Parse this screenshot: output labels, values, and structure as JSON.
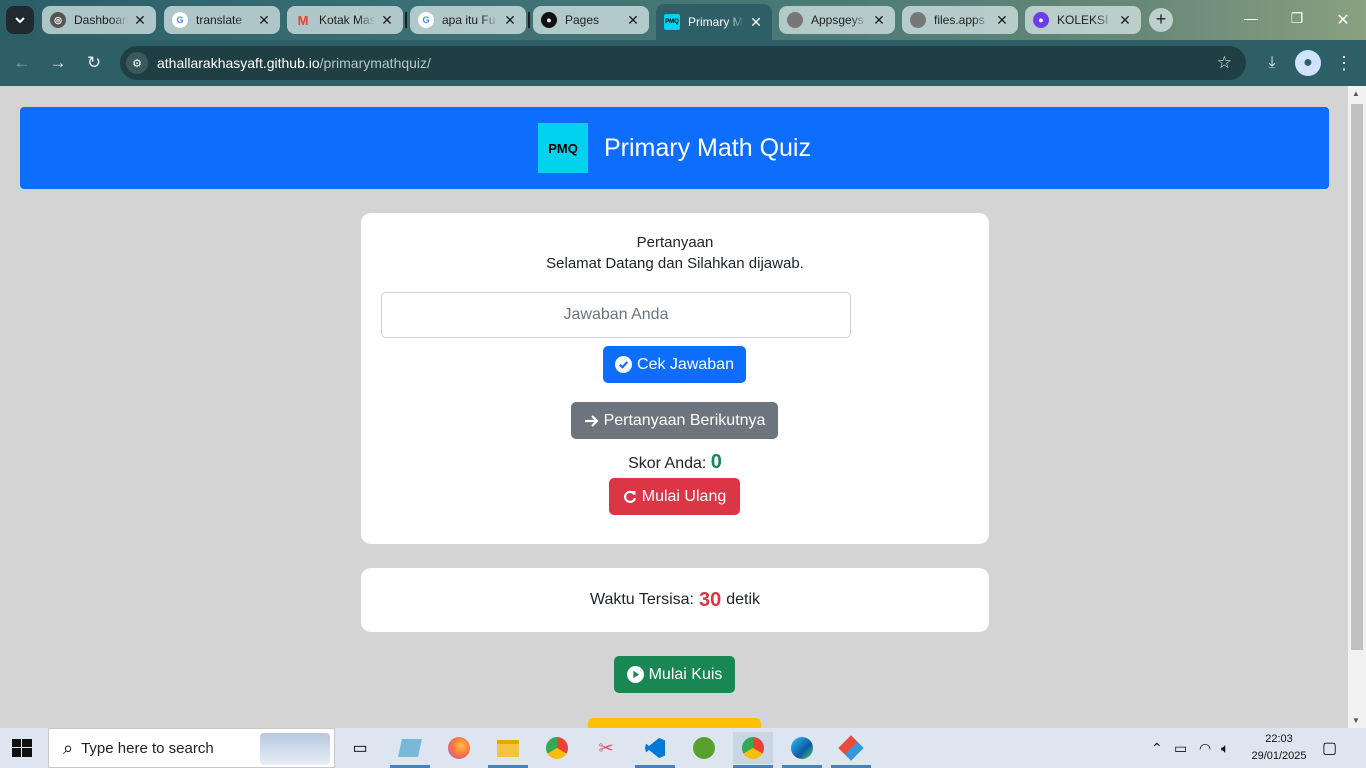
{
  "browser": {
    "tabs": [
      {
        "label": "Dashboard",
        "favicon": "openai-icon",
        "color": "#555555"
      },
      {
        "label": "translate",
        "favicon": "google-icon",
        "color": "#4285f4"
      },
      {
        "label": "Kotak Masuk",
        "favicon": "gmail-icon",
        "color": "#ea4335"
      },
      {
        "label": "apa itu Fu",
        "favicon": "google-icon",
        "color": "#4285f4"
      },
      {
        "label": "Pages",
        "favicon": "github-icon",
        "color": "#111111"
      },
      {
        "label": "Primary M",
        "favicon": "pmq-icon",
        "color": "#00d2f0"
      },
      {
        "label": "Appsgeys",
        "favicon": "globe-icon",
        "color": "#777777"
      },
      {
        "label": "files.apps",
        "favicon": "globe-icon",
        "color": "#777777"
      },
      {
        "label": "KOLEKSI F",
        "favicon": "shield-icon",
        "color": "#6a3de8"
      }
    ],
    "url_domain": "athallarakhasyaft.github.io",
    "url_path": "/primarymathquiz/"
  },
  "page": {
    "logo_text": "PMQ",
    "header_title": "Primary Math Quiz",
    "question_title": "Pertanyaan",
    "question_text": "Selamat Datang dan Silahkan dijawab.",
    "answer_placeholder": "Jawaban Anda",
    "check_button": "Cek Jawaban",
    "next_button": "Pertanyaan Berikutnya",
    "score_label": "Skor Anda:",
    "score_value": "0",
    "reset_button": "Mulai Ulang",
    "timer_label": "Waktu Tersisa:",
    "timer_value": "30",
    "timer_unit": "detik",
    "start_button": "Mulai Kuis"
  },
  "taskbar": {
    "search_placeholder": "Type here to search",
    "time": "22:03",
    "date": "29/01/2025"
  },
  "colors": {
    "primary": "#0d6efd",
    "secondary": "#6c757d",
    "danger": "#dc3545",
    "success": "#198754",
    "warning": "#ffc107"
  }
}
